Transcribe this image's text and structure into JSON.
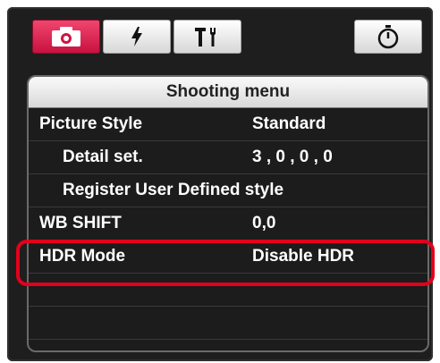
{
  "tabs": [
    {
      "icon": "camera-icon",
      "active": true
    },
    {
      "icon": "flash-icon",
      "active": false
    },
    {
      "icon": "tools-icon",
      "active": false
    }
  ],
  "timer_tab": {
    "icon": "timer-icon"
  },
  "menu": {
    "title": "Shooting menu",
    "rows": [
      {
        "label": "Picture Style",
        "value": "Standard"
      },
      {
        "label": "Detail set.",
        "value": "3 , 0 , 0 , 0"
      },
      {
        "label": "Register User Defined style",
        "value": ""
      },
      {
        "label": "WB SHIFT",
        "value": "0,0"
      },
      {
        "label": "HDR Mode",
        "value": "Disable HDR"
      }
    ]
  },
  "colors": {
    "active_tab": "#e0204f",
    "highlight": "#e3001b",
    "panel_bg": "#1e1e1e"
  }
}
